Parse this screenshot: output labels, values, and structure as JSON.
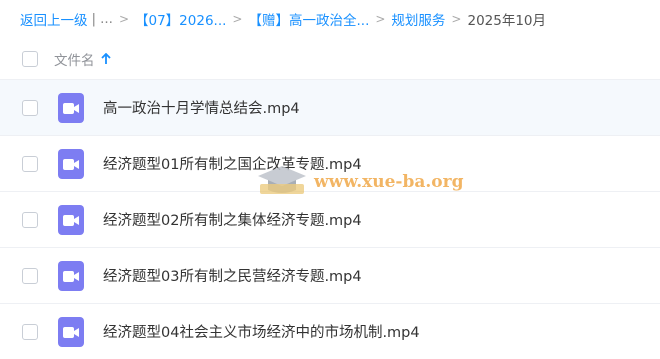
{
  "breadcrumb": {
    "back": "返回上一级",
    "ellipsis": "...",
    "crumb1": "【07】2026...",
    "crumb2": "【赠】高一政治全...",
    "crumb3": "规划服务",
    "current": "2025年10月",
    "separator": ">",
    "divider": "|"
  },
  "header": {
    "column_name": "文件名",
    "sort": "ascending"
  },
  "files": [
    {
      "name": "高一政治十月学情总结会.mp4",
      "icon": "video-icon"
    },
    {
      "name": "经济题型01所有制之国企改革专题.mp4",
      "icon": "video-icon"
    },
    {
      "name": "经济题型02所有制之集体经济专题.mp4",
      "icon": "video-icon"
    },
    {
      "name": "经济题型03所有制之民营经济专题.mp4",
      "icon": "video-icon"
    },
    {
      "name": "经济题型04社会主义市场经济中的市场机制.mp4",
      "icon": "video-icon"
    }
  ],
  "watermark": {
    "text": "www.xue-ba.org"
  },
  "colors": {
    "link": "#1890ff",
    "file_icon": "#7d7df2",
    "watermark": "#f0a94a"
  }
}
